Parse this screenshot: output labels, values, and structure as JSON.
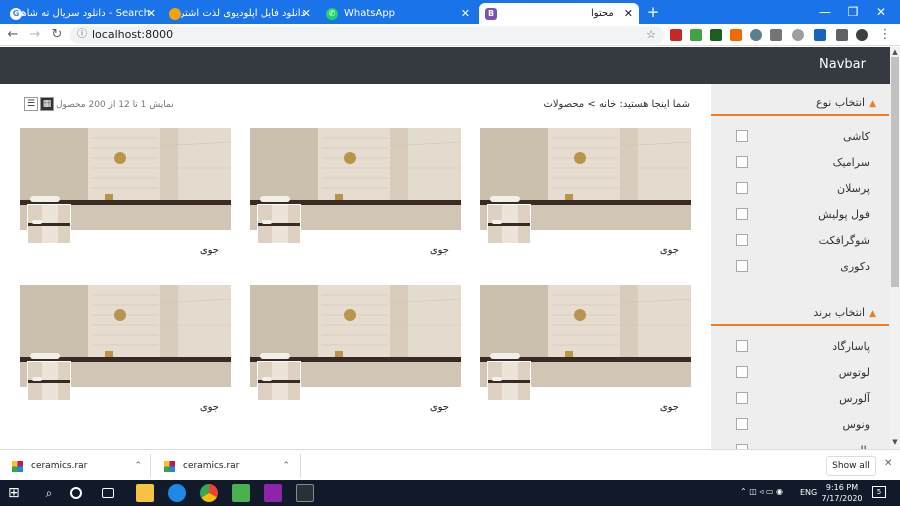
{
  "browser": {
    "tabs": [
      {
        "title": "Search - دانلود سریال ته شاهین",
        "favicon": "G",
        "active": false
      },
      {
        "title": "دانلود فایل آپلودیوی لذت اشتراک آ...",
        "favicon": "orange-icon",
        "active": false
      },
      {
        "title": "WhatsApp",
        "favicon": "whatsapp-icon",
        "active": false
      },
      {
        "title": "محتوا",
        "favicon": "B",
        "active": true
      }
    ],
    "new_tab": "+",
    "url": "localhost:8000"
  },
  "page": {
    "brand": "Navbar",
    "breadcrumb": "شما اینجا هستید: خانه > محصولات",
    "result_count": "نمایش 1 تا 12 از 200 محصول",
    "products": [
      {
        "name": "جوی"
      },
      {
        "name": "جوی"
      },
      {
        "name": "جوی"
      },
      {
        "name": "جوی"
      },
      {
        "name": "جوی"
      },
      {
        "name": "جوی"
      }
    ]
  },
  "sidebar": {
    "type_title": "انتخاب نوع",
    "types": [
      "کاشی",
      "سرامیک",
      "پرسلان",
      "فول پولیش",
      "شوگرافکت",
      "دکوری"
    ],
    "brand_title": "انتخاب برند",
    "brands": [
      "پاسارگاد",
      "لوتوس",
      "آلورس",
      "ونوس",
      "بالیسن"
    ]
  },
  "downloads": {
    "items": [
      "ceramics.rar",
      "ceramics.rar"
    ],
    "show_all": "Show all"
  },
  "taskbar": {
    "time": "9:16 PM",
    "date": "7/17/2020",
    "lang": "ENG",
    "notifications": "5"
  },
  "colors": {
    "chrome_blue": "#1a73e8",
    "navbar": "#343a40",
    "accent_orange": "#f07c21",
    "sidebar_bg": "#eeeeee",
    "taskbar": "#101a2a"
  }
}
